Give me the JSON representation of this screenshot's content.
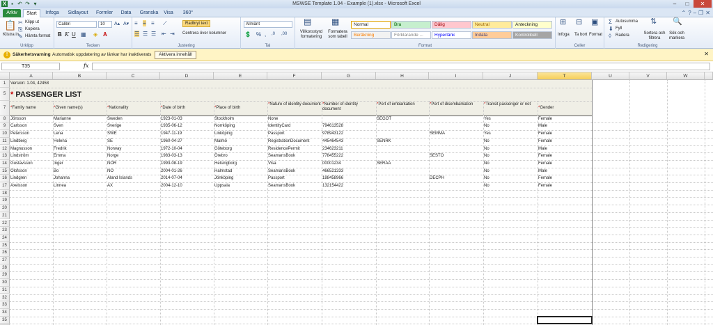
{
  "window": {
    "title": "MSWSE Template 1.04 - Example (1).xlsx - Microsoft Excel",
    "qat_icons": [
      "excel-logo-icon",
      "save-icon",
      "undo-icon",
      "redo-icon",
      "customize-icon"
    ],
    "win_buttons": [
      "minimize-icon",
      "maximize-icon",
      "close-icon"
    ]
  },
  "tabs": [
    {
      "label": "Arkiv"
    },
    {
      "label": "Start"
    },
    {
      "label": "Infoga"
    },
    {
      "label": "Sidlayout"
    },
    {
      "label": "Formler"
    },
    {
      "label": "Data"
    },
    {
      "label": "Granska"
    },
    {
      "label": "Visa"
    },
    {
      "label": "360°"
    }
  ],
  "ribbon": {
    "clipboard": {
      "paste": "Klistra in",
      "cut": "Klipp ut",
      "copy": "Kopiera",
      "format_painter": "Hämta format",
      "label": "Urklipp"
    },
    "font": {
      "name": "Calibri",
      "size": "10",
      "label": "Tecken"
    },
    "alignment": {
      "wrap": "Radbryt text",
      "merge": "Centrera över kolumner",
      "label": "Justering"
    },
    "number": {
      "format": "Allmänt",
      "label": "Tal"
    },
    "styles": {
      "cond": "Villkorsstyrd formatering",
      "table": "Formatera som tabell",
      "cells": [
        {
          "label": "Normal",
          "bg": "#ffffff",
          "fg": "#222222"
        },
        {
          "label": "Bra",
          "bg": "#c6efce",
          "fg": "#006100"
        },
        {
          "label": "Dålig",
          "bg": "#ffc7ce",
          "fg": "#9c0006"
        },
        {
          "label": "Neutral",
          "bg": "#ffeb9c",
          "fg": "#9c6500"
        },
        {
          "label": "Anteckning",
          "bg": "#ffffcc",
          "fg": "#222222"
        },
        {
          "label": "Beräkning",
          "bg": "#f2f2f2",
          "fg": "#fa7d00"
        },
        {
          "label": "Förklarande ...",
          "bg": "#ffffff",
          "fg": "#7f7f7f"
        },
        {
          "label": "Hyperlänk",
          "bg": "#ffffff",
          "fg": "#0000ff"
        },
        {
          "label": "Indata",
          "bg": "#ffcc99",
          "fg": "#3f3f76"
        },
        {
          "label": "Kontrollcell",
          "bg": "#a5a5a5",
          "fg": "#ffffff"
        }
      ],
      "label": "Format"
    },
    "cells": {
      "insert": "Infoga",
      "delete": "Ta bort",
      "format": "Format",
      "label": "Celler"
    },
    "editing": {
      "autosum": "Autosumma",
      "fill": "Fyll",
      "clear": "Radera",
      "sort": "Sortera och filtrera",
      "find": "Sök och markera",
      "label": "Redigering"
    }
  },
  "message_bar": {
    "title": "Säkerhetsvarning",
    "text": "Automatisk uppdatering av länkar har inaktiverats",
    "button": "Aktivera innehåll"
  },
  "formula_bar": {
    "name_box": "T35",
    "fx": "fx",
    "value": ""
  },
  "columns": [
    "A",
    "B",
    "C",
    "D",
    "E",
    "F",
    "G",
    "H",
    "I",
    "J",
    "T",
    "U",
    "V",
    "W"
  ],
  "selected_column": "T",
  "sheet": {
    "version": "Version: 1.04, 42458",
    "title": "PASSENGER LIST",
    "star": "*",
    "headers": [
      "Family name",
      "Given name(s)",
      "Nationality",
      "Date of birth",
      "Place of birth",
      "Nature of identity document",
      "Number of identity document",
      "Port of embarkation",
      "Port of disembarkation",
      "Transit passenger or not",
      "Gender"
    ],
    "row_numbers": [
      "1",
      "5",
      "7",
      "8",
      "9",
      "10",
      "11",
      "12",
      "13",
      "14",
      "15",
      "16",
      "17",
      "18",
      "19",
      "20",
      "21",
      "22",
      "23",
      "24",
      "25",
      "26",
      "27",
      "28",
      "29",
      "30",
      "31",
      "32",
      "33",
      "34",
      "35"
    ],
    "rows": [
      [
        "Jönsson",
        "Marianne",
        "Sweden",
        "1923-01-03",
        "Stockholm",
        "None",
        "",
        "SEGOT",
        "",
        "Yes",
        "Female"
      ],
      [
        "Carlsson",
        "Sven",
        "Sverige",
        "1935-06-12",
        "Norrköping",
        "IdentityCard",
        "794613528",
        "",
        "",
        "No",
        "Male"
      ],
      [
        "Petersson",
        "Lena",
        "SWE",
        "1947-11-19",
        "Linköping",
        "Passport",
        "978943122",
        "",
        "SEMMA",
        "Yes",
        "Female"
      ],
      [
        "Lindberg",
        "Helena",
        "SE",
        "1960-04-27",
        "Malmö",
        "RegistrationDocument",
        "445464543",
        "SENRK",
        "",
        "No",
        "Female"
      ],
      [
        "Magnusson",
        "Fredrik",
        "Norway",
        "1972-10-04",
        "Göteborg",
        "ResidencePermit",
        "234623211",
        "",
        "",
        "No",
        "Male"
      ],
      [
        "Lindström",
        "Emma",
        "Norge",
        "1983-03-13",
        "Örebro",
        "SeamansBook",
        "778455222",
        "",
        "SESTO",
        "No",
        "Female"
      ],
      [
        "Gustavsson",
        "Inger",
        "NOR",
        "1993-08-19",
        "Helsingborg",
        "Visa",
        "00001234",
        "SERAA",
        "",
        "No",
        "Female"
      ],
      [
        "Olofsson",
        "Bo",
        "NO",
        "2004-01-26",
        "Halmstad",
        "SeamansBook",
        "466521333",
        "",
        "",
        "No",
        "Male"
      ],
      [
        "Lindgren",
        "Johanna",
        "Aland Islands",
        "2014-07-04",
        "Jönköping",
        "Passport",
        "188458966",
        "",
        "DECPH",
        "No",
        "Female"
      ],
      [
        "Axelsson",
        "Linnea",
        "AX",
        "2004-12-10",
        "Uppsala",
        "SeamansBook",
        "132154422",
        "",
        "",
        "No",
        "Female"
      ]
    ]
  }
}
